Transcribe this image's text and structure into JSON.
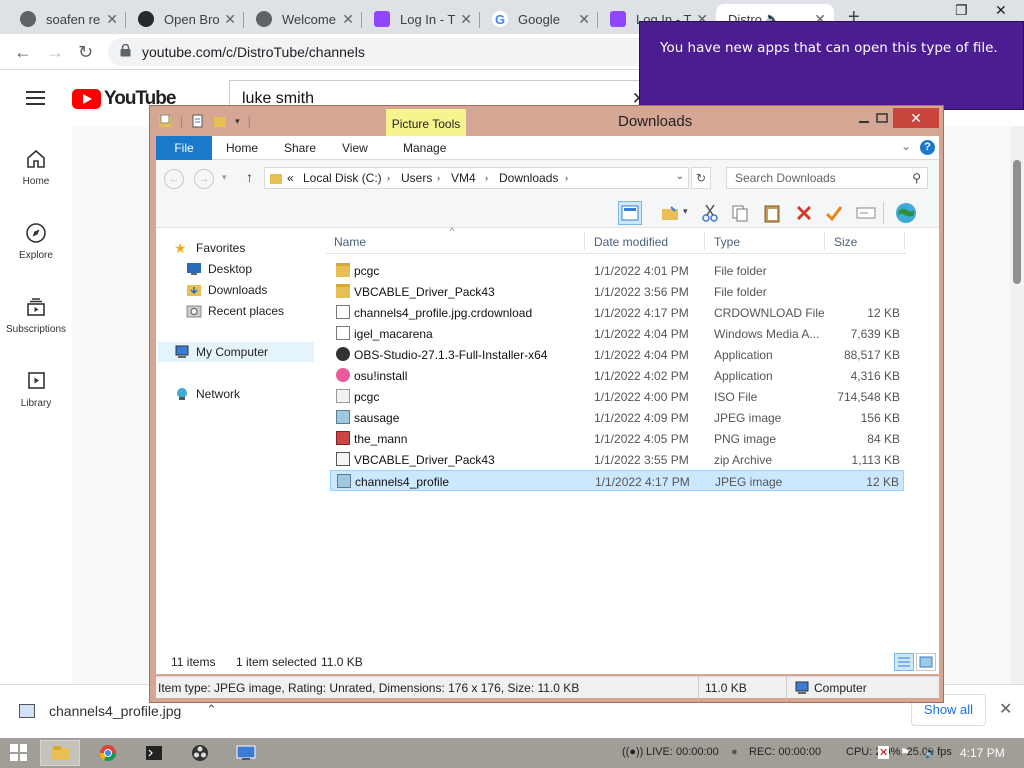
{
  "browser": {
    "tabs": [
      {
        "title": "soafen re",
        "icon": "globe-icon"
      },
      {
        "title": "Open Bro",
        "icon": "github-icon"
      },
      {
        "title": "Welcome",
        "icon": "globe-icon"
      },
      {
        "title": "Log In - T",
        "icon": "twitch-icon"
      },
      {
        "title": "Google",
        "icon": "google-icon"
      },
      {
        "title": "Log In - T",
        "icon": "twitch-icon"
      },
      {
        "title": "Distro",
        "icon": "youtube-icon",
        "active": true
      }
    ],
    "url": "youtube.com/c/DistroTube/channels"
  },
  "youtube": {
    "logo_text": "YouTube",
    "search_query": "luke smith",
    "sidebar": [
      {
        "label": "Home",
        "icon": "home-icon"
      },
      {
        "label": "Explore",
        "icon": "compass-icon"
      },
      {
        "label": "Subscriptions",
        "icon": "subscriptions-icon"
      },
      {
        "label": "Library",
        "icon": "library-icon"
      }
    ]
  },
  "notification": {
    "text": "You have new apps that can open this type of file."
  },
  "explorer": {
    "title": "Downloads",
    "contextual_tab": "Picture Tools",
    "ribbon_tabs": [
      "File",
      "Home",
      "Share",
      "View",
      "Manage"
    ],
    "breadcrumb": {
      "prefix": "«",
      "segments": [
        "Local Disk (C:)",
        "Users",
        "VM4",
        "Downloads"
      ]
    },
    "search_placeholder": "Search Downloads",
    "nav": {
      "favorites": "Favorites",
      "favorite_items": [
        "Desktop",
        "Downloads",
        "Recent places"
      ],
      "computer": "My Computer",
      "network": "Network"
    },
    "columns": {
      "name": "Name",
      "date": "Date modified",
      "type": "Type",
      "size": "Size"
    },
    "files": [
      {
        "name": "pcgc",
        "date": "1/1/2022 4:01 PM",
        "type": "File folder",
        "size": "",
        "icon": "folder"
      },
      {
        "name": "VBCABLE_Driver_Pack43",
        "date": "1/1/2022 3:56 PM",
        "type": "File folder",
        "size": "",
        "icon": "folder"
      },
      {
        "name": "channels4_profile.jpg.crdownload",
        "date": "1/1/2022 4:17 PM",
        "type": "CRDOWNLOAD File",
        "size": "12 KB",
        "icon": "doc"
      },
      {
        "name": "igel_macarena",
        "date": "1/1/2022 4:04 PM",
        "type": "Windows Media A...",
        "size": "7,639 KB",
        "icon": "wmv"
      },
      {
        "name": "OBS-Studio-27.1.3-Full-Installer-x64",
        "date": "1/1/2022 4:04 PM",
        "type": "Application",
        "size": "88,517 KB",
        "icon": "obs"
      },
      {
        "name": "osu!install",
        "date": "1/1/2022 4:02 PM",
        "type": "Application",
        "size": "4,316 KB",
        "icon": "osu"
      },
      {
        "name": "pcgc",
        "date": "1/1/2022 4:00 PM",
        "type": "ISO File",
        "size": "714,548 KB",
        "icon": "iso"
      },
      {
        "name": "sausage",
        "date": "1/1/2022 4:09 PM",
        "type": "JPEG image",
        "size": "156 KB",
        "icon": "jpg"
      },
      {
        "name": "the_mann",
        "date": "1/1/2022 4:05 PM",
        "type": "PNG image",
        "size": "84 KB",
        "icon": "png"
      },
      {
        "name": "VBCABLE_Driver_Pack43",
        "date": "1/1/2022 3:55 PM",
        "type": "zip Archive",
        "size": "1,113 KB",
        "icon": "zip"
      },
      {
        "name": "channels4_profile",
        "date": "1/1/2022 4:17 PM",
        "type": "JPEG image",
        "size": "12 KB",
        "icon": "jpg",
        "selected": true
      }
    ],
    "status": {
      "count": "11 items",
      "selected": "1 item selected",
      "selected_size": "11.0 KB"
    },
    "details": {
      "info": "Item type: JPEG image, Rating: Unrated, Dimensions: 176 x 176, Size: 11.0 KB",
      "size": "11.0 KB",
      "location": "Computer"
    }
  },
  "download_shelf": {
    "filename": "channels4_profile.jpg",
    "show_all": "Show all"
  },
  "taskbar": {
    "live": "LIVE: 00:00:00",
    "rec": "REC: 00:00:00",
    "cpu": "CPU: 2.0%, 25.00 fps",
    "time": "4:17 PM"
  },
  "colors": {
    "notification_bg": "#4c1c91",
    "explorer_frame": "#d6a695",
    "ribbon_file": "#1979ca",
    "selection": "#cce8ff",
    "youtube_red": "#ff0000"
  }
}
